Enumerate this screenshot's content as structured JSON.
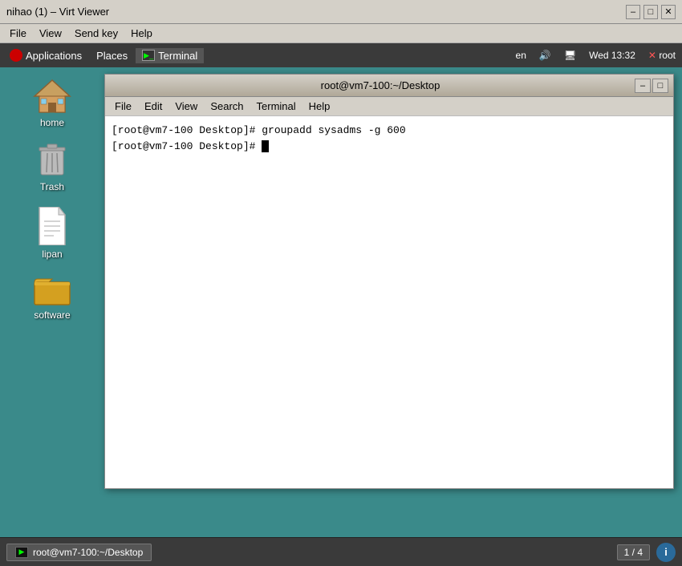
{
  "virt_viewer": {
    "title": "nihao (1) – Virt Viewer",
    "menu": {
      "file": "File",
      "view": "View",
      "send_key": "Send key",
      "help": "Help"
    },
    "title_buttons": {
      "minimize": "–",
      "maximize": "□",
      "close": "✕"
    }
  },
  "gnome_panel": {
    "applications": "Applications",
    "places": "Places",
    "terminal": "Terminal",
    "locale": "en",
    "datetime": "Wed 13:32",
    "user": "root"
  },
  "desktop_icons": [
    {
      "id": "home",
      "label": "home",
      "type": "home"
    },
    {
      "id": "trash",
      "label": "Trash",
      "type": "trash"
    },
    {
      "id": "lipan",
      "label": "lipan",
      "type": "document"
    },
    {
      "id": "software",
      "label": "software",
      "type": "folder"
    }
  ],
  "terminal_window": {
    "title": "root@vm7-100:~/Desktop",
    "menu": {
      "file": "File",
      "edit": "Edit",
      "view": "View",
      "search": "Search",
      "terminal": "Terminal",
      "help": "Help"
    },
    "lines": [
      "[root@vm7-100 Desktop]# groupadd sysadms -g 600",
      "[root@vm7-100 Desktop]# "
    ],
    "minimize": "–",
    "maximize": "□"
  },
  "taskbar": {
    "active_window": "root@vm7-100:~/Desktop",
    "terminal_icon": ">_",
    "pager": "1 / 4"
  }
}
